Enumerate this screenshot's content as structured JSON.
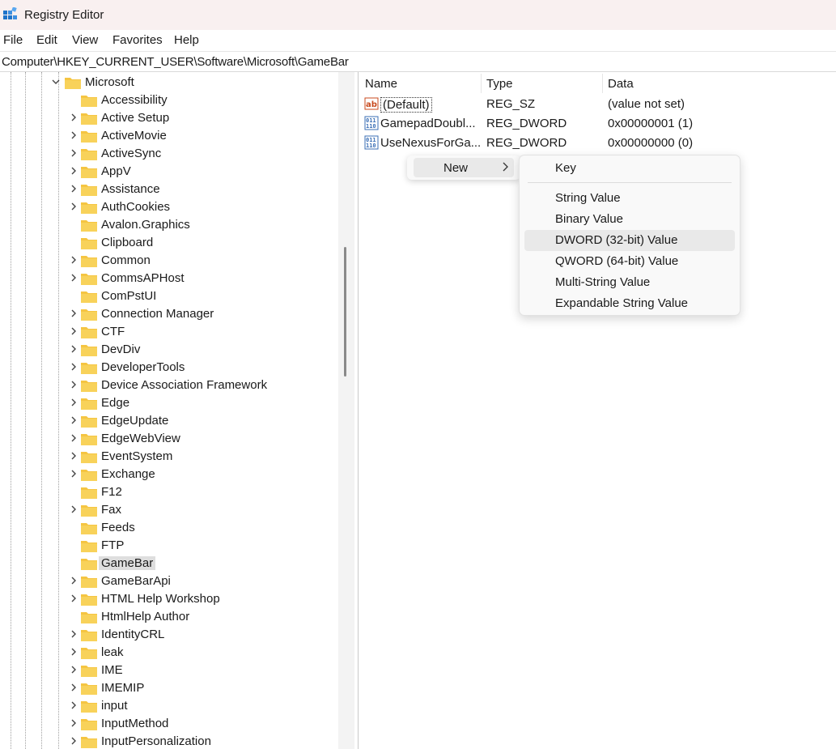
{
  "window": {
    "title": "Registry Editor"
  },
  "menubar": [
    "File",
    "Edit",
    "View",
    "Favorites",
    "Help"
  ],
  "address": "Computer\\HKEY_CURRENT_USER\\Software\\Microsoft\\GameBar",
  "tree": {
    "parent": "Microsoft",
    "items": [
      {
        "label": "Accessibility",
        "expandable": false
      },
      {
        "label": "Active Setup",
        "expandable": true
      },
      {
        "label": "ActiveMovie",
        "expandable": true
      },
      {
        "label": "ActiveSync",
        "expandable": true
      },
      {
        "label": "AppV",
        "expandable": true
      },
      {
        "label": "Assistance",
        "expandable": true
      },
      {
        "label": "AuthCookies",
        "expandable": true
      },
      {
        "label": "Avalon.Graphics",
        "expandable": false
      },
      {
        "label": "Clipboard",
        "expandable": false
      },
      {
        "label": "Common",
        "expandable": true
      },
      {
        "label": "CommsAPHost",
        "expandable": true
      },
      {
        "label": "ComPstUI",
        "expandable": false
      },
      {
        "label": "Connection Manager",
        "expandable": true
      },
      {
        "label": "CTF",
        "expandable": true
      },
      {
        "label": "DevDiv",
        "expandable": true
      },
      {
        "label": "DeveloperTools",
        "expandable": true
      },
      {
        "label": "Device Association Framework",
        "expandable": true
      },
      {
        "label": "Edge",
        "expandable": true
      },
      {
        "label": "EdgeUpdate",
        "expandable": true
      },
      {
        "label": "EdgeWebView",
        "expandable": true
      },
      {
        "label": "EventSystem",
        "expandable": true
      },
      {
        "label": "Exchange",
        "expandable": true
      },
      {
        "label": "F12",
        "expandable": false
      },
      {
        "label": "Fax",
        "expandable": true
      },
      {
        "label": "Feeds",
        "expandable": false
      },
      {
        "label": "FTP",
        "expandable": false
      },
      {
        "label": "GameBar",
        "expandable": false,
        "selected": true
      },
      {
        "label": "GameBarApi",
        "expandable": true
      },
      {
        "label": "HTML Help Workshop",
        "expandable": true
      },
      {
        "label": "HtmlHelp Author",
        "expandable": false
      },
      {
        "label": "IdentityCRL",
        "expandable": true
      },
      {
        "label": "leak",
        "expandable": true
      },
      {
        "label": "IME",
        "expandable": true
      },
      {
        "label": "IMEMIP",
        "expandable": true
      },
      {
        "label": "input",
        "expandable": true
      },
      {
        "label": "InputMethod",
        "expandable": true
      },
      {
        "label": "InputPersonalization",
        "expandable": true
      }
    ]
  },
  "list": {
    "columns": [
      "Name",
      "Type",
      "Data"
    ],
    "rows": [
      {
        "name": "(Default)",
        "type": "REG_SZ",
        "data": "(value not set)",
        "icon": "string-value-icon"
      },
      {
        "name": "GamepadDoubl...",
        "type": "REG_DWORD",
        "data": "0x00000001 (1)",
        "icon": "binary-value-icon"
      },
      {
        "name": "UseNexusForGa...",
        "type": "REG_DWORD",
        "data": "0x00000000 (0)",
        "icon": "binary-value-icon"
      }
    ]
  },
  "context_menu": {
    "new_label": "New"
  },
  "submenu": {
    "items": [
      "Key",
      "String Value",
      "Binary Value",
      "DWORD (32-bit) Value",
      "QWORD (64-bit) Value",
      "Multi-String Value",
      "Expandable String Value"
    ],
    "hovered": "DWORD (32-bit) Value"
  },
  "colors": {
    "folder": "#f5c542",
    "accent": "#1f73c9",
    "selected_bg": "#dedede",
    "hover_bg": "#e9e9e9"
  }
}
